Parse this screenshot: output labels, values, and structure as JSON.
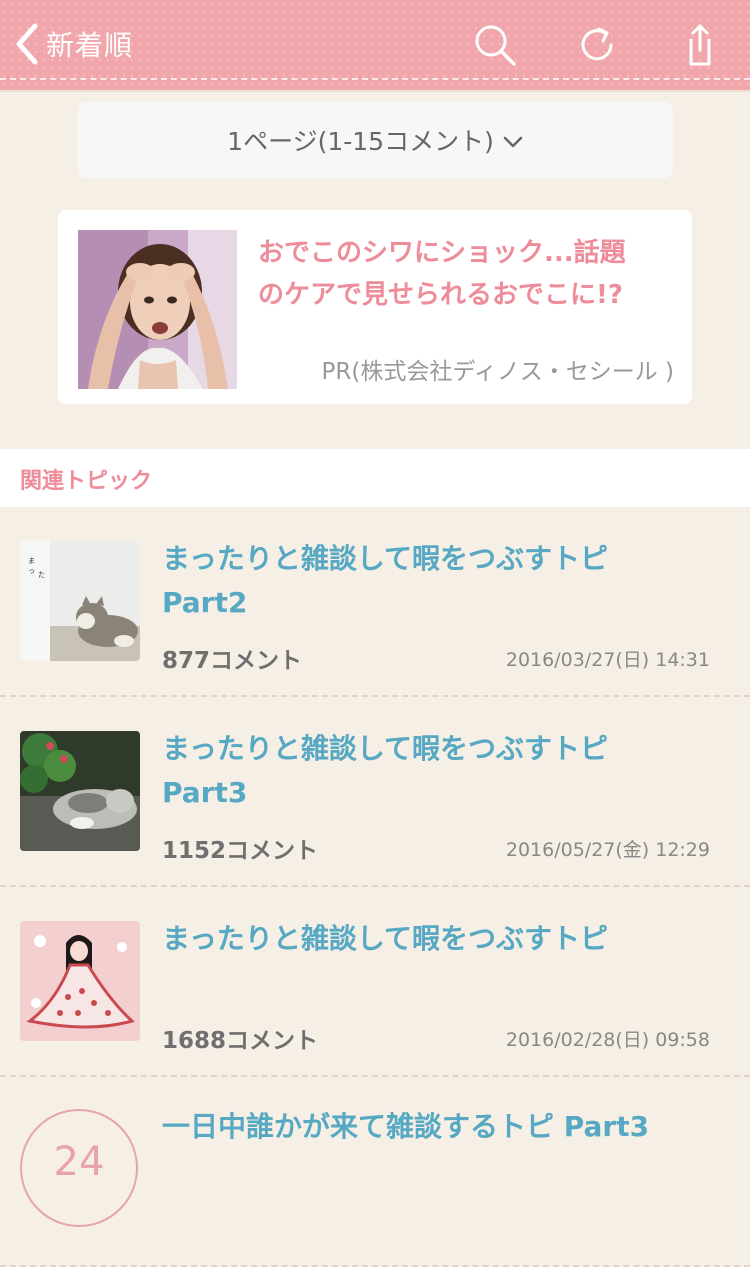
{
  "header": {
    "back_label": "新着順",
    "bg_color": "#f1a6ab"
  },
  "page_selector": {
    "label": "1ページ(1-15コメント)"
  },
  "ad": {
    "title_line1": "おでこのシワにショック...話題",
    "title_line2": "のケアで見せられるおでこに!?",
    "sponsor": "PR(株式会社ディノス・セシール )",
    "title_color": "#ee8c9a"
  },
  "related": {
    "label": "関連トピック",
    "items": [
      {
        "title_line1": "まったりと雑談して暇をつぶすトピ",
        "title_line2": "Part2",
        "count": "877コメント",
        "date": "2016/03/27(日) 14:31",
        "thumb": "cat-doll-thumbnail"
      },
      {
        "title_line1": "まったりと雑談して暇をつぶすトピ",
        "title_line2": "Part3",
        "count": "1152コメント",
        "date": "2016/05/27(金) 12:29",
        "thumb": "sleeping-cat-thumbnail"
      },
      {
        "title_line1": "まったりと雑談して暇をつぶすトピ",
        "title_line2": "",
        "count": "1688コメント",
        "date": "2016/02/28(日) 09:58",
        "thumb": "girl-illustration-thumbnail"
      },
      {
        "title_line1": "一日中誰かが来て雑談するトピ Part3",
        "title_line2": "",
        "badge": "24"
      }
    ],
    "title_color": "#57a8c2"
  }
}
